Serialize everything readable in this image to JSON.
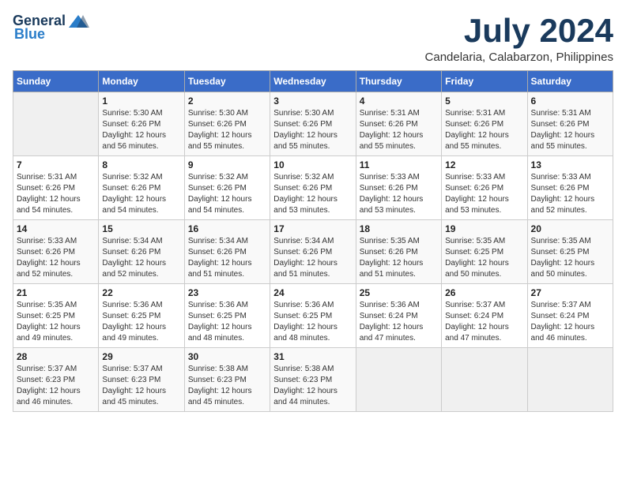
{
  "header": {
    "logo_general": "General",
    "logo_blue": "Blue",
    "month_title": "July 2024",
    "location": "Candelaria, Calabarzon, Philippines"
  },
  "days_of_week": [
    "Sunday",
    "Monday",
    "Tuesday",
    "Wednesday",
    "Thursday",
    "Friday",
    "Saturday"
  ],
  "weeks": [
    [
      {
        "day": "",
        "info": ""
      },
      {
        "day": "1",
        "info": "Sunrise: 5:30 AM\nSunset: 6:26 PM\nDaylight: 12 hours\nand 56 minutes."
      },
      {
        "day": "2",
        "info": "Sunrise: 5:30 AM\nSunset: 6:26 PM\nDaylight: 12 hours\nand 55 minutes."
      },
      {
        "day": "3",
        "info": "Sunrise: 5:30 AM\nSunset: 6:26 PM\nDaylight: 12 hours\nand 55 minutes."
      },
      {
        "day": "4",
        "info": "Sunrise: 5:31 AM\nSunset: 6:26 PM\nDaylight: 12 hours\nand 55 minutes."
      },
      {
        "day": "5",
        "info": "Sunrise: 5:31 AM\nSunset: 6:26 PM\nDaylight: 12 hours\nand 55 minutes."
      },
      {
        "day": "6",
        "info": "Sunrise: 5:31 AM\nSunset: 6:26 PM\nDaylight: 12 hours\nand 55 minutes."
      }
    ],
    [
      {
        "day": "7",
        "info": "Sunrise: 5:31 AM\nSunset: 6:26 PM\nDaylight: 12 hours\nand 54 minutes."
      },
      {
        "day": "8",
        "info": "Sunrise: 5:32 AM\nSunset: 6:26 PM\nDaylight: 12 hours\nand 54 minutes."
      },
      {
        "day": "9",
        "info": "Sunrise: 5:32 AM\nSunset: 6:26 PM\nDaylight: 12 hours\nand 54 minutes."
      },
      {
        "day": "10",
        "info": "Sunrise: 5:32 AM\nSunset: 6:26 PM\nDaylight: 12 hours\nand 53 minutes."
      },
      {
        "day": "11",
        "info": "Sunrise: 5:33 AM\nSunset: 6:26 PM\nDaylight: 12 hours\nand 53 minutes."
      },
      {
        "day": "12",
        "info": "Sunrise: 5:33 AM\nSunset: 6:26 PM\nDaylight: 12 hours\nand 53 minutes."
      },
      {
        "day": "13",
        "info": "Sunrise: 5:33 AM\nSunset: 6:26 PM\nDaylight: 12 hours\nand 52 minutes."
      }
    ],
    [
      {
        "day": "14",
        "info": "Sunrise: 5:33 AM\nSunset: 6:26 PM\nDaylight: 12 hours\nand 52 minutes."
      },
      {
        "day": "15",
        "info": "Sunrise: 5:34 AM\nSunset: 6:26 PM\nDaylight: 12 hours\nand 52 minutes."
      },
      {
        "day": "16",
        "info": "Sunrise: 5:34 AM\nSunset: 6:26 PM\nDaylight: 12 hours\nand 51 minutes."
      },
      {
        "day": "17",
        "info": "Sunrise: 5:34 AM\nSunset: 6:26 PM\nDaylight: 12 hours\nand 51 minutes."
      },
      {
        "day": "18",
        "info": "Sunrise: 5:35 AM\nSunset: 6:26 PM\nDaylight: 12 hours\nand 51 minutes."
      },
      {
        "day": "19",
        "info": "Sunrise: 5:35 AM\nSunset: 6:25 PM\nDaylight: 12 hours\nand 50 minutes."
      },
      {
        "day": "20",
        "info": "Sunrise: 5:35 AM\nSunset: 6:25 PM\nDaylight: 12 hours\nand 50 minutes."
      }
    ],
    [
      {
        "day": "21",
        "info": "Sunrise: 5:35 AM\nSunset: 6:25 PM\nDaylight: 12 hours\nand 49 minutes."
      },
      {
        "day": "22",
        "info": "Sunrise: 5:36 AM\nSunset: 6:25 PM\nDaylight: 12 hours\nand 49 minutes."
      },
      {
        "day": "23",
        "info": "Sunrise: 5:36 AM\nSunset: 6:25 PM\nDaylight: 12 hours\nand 48 minutes."
      },
      {
        "day": "24",
        "info": "Sunrise: 5:36 AM\nSunset: 6:25 PM\nDaylight: 12 hours\nand 48 minutes."
      },
      {
        "day": "25",
        "info": "Sunrise: 5:36 AM\nSunset: 6:24 PM\nDaylight: 12 hours\nand 47 minutes."
      },
      {
        "day": "26",
        "info": "Sunrise: 5:37 AM\nSunset: 6:24 PM\nDaylight: 12 hours\nand 47 minutes."
      },
      {
        "day": "27",
        "info": "Sunrise: 5:37 AM\nSunset: 6:24 PM\nDaylight: 12 hours\nand 46 minutes."
      }
    ],
    [
      {
        "day": "28",
        "info": "Sunrise: 5:37 AM\nSunset: 6:23 PM\nDaylight: 12 hours\nand 46 minutes."
      },
      {
        "day": "29",
        "info": "Sunrise: 5:37 AM\nSunset: 6:23 PM\nDaylight: 12 hours\nand 45 minutes."
      },
      {
        "day": "30",
        "info": "Sunrise: 5:38 AM\nSunset: 6:23 PM\nDaylight: 12 hours\nand 45 minutes."
      },
      {
        "day": "31",
        "info": "Sunrise: 5:38 AM\nSunset: 6:23 PM\nDaylight: 12 hours\nand 44 minutes."
      },
      {
        "day": "",
        "info": ""
      },
      {
        "day": "",
        "info": ""
      },
      {
        "day": "",
        "info": ""
      }
    ]
  ]
}
